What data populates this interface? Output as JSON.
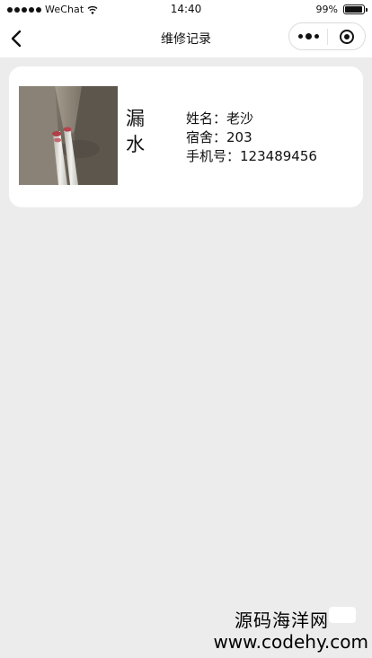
{
  "status_bar": {
    "carrier": "WeChat",
    "time": "14:40",
    "battery": "99%",
    "battery_level": 0.99
  },
  "nav": {
    "title": "维修记录"
  },
  "record": {
    "type": "漏水",
    "name_label": "姓名：",
    "name": "老沙",
    "dorm_label": "宿舍：",
    "dorm": "203",
    "phone_label": "手机号：",
    "phone": "123489456"
  },
  "watermark": {
    "cn": "源码海洋网",
    "url": "www.codehy.com"
  },
  "icons": {
    "back": "back-arrow-icon",
    "more": "more-dots-icon",
    "close": "target-icon",
    "wifi": "wifi-icon",
    "battery": "battery-icon"
  }
}
